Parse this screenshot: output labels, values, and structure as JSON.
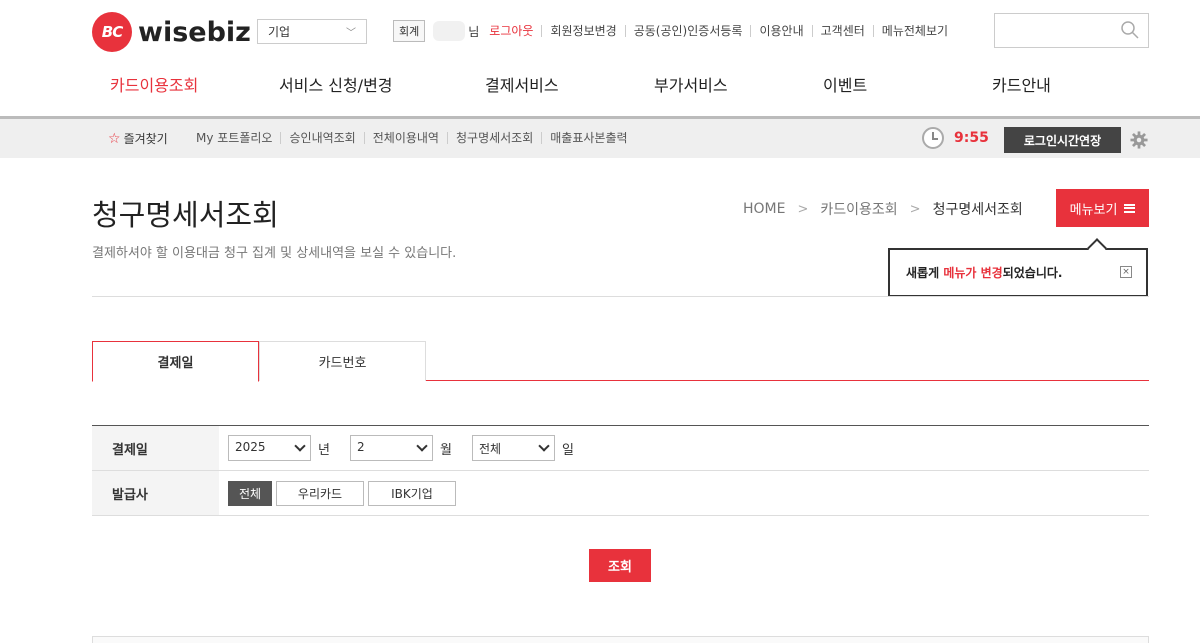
{
  "header": {
    "logo_mark": "BC",
    "logo_text": "wisebiz",
    "company_select": "기업",
    "member_tag": "회계",
    "name_suffix": "님",
    "util_links": [
      "로그아웃",
      "회원정보변경",
      "공동(공인)인증서등록",
      "이용안내",
      "고객센터",
      "메뉴전체보기"
    ],
    "search_placeholder": ""
  },
  "gnb": {
    "items": [
      "카드이용조회",
      "서비스 신청/변경",
      "결제서비스",
      "부가서비스",
      "이벤트",
      "카드안내"
    ]
  },
  "subbar": {
    "favorites": "즐겨찾기",
    "links": [
      "My 포트폴리오",
      "승인내역조회",
      "전체이용내역",
      "청구명세서조회",
      "매출표사본출력"
    ],
    "timer": "9:55",
    "extend_label": "로그인시간연장"
  },
  "page": {
    "title": "청구명세서조회",
    "desc": "결제하셔야 할 이용대금 청구 집계 및 상세내역을 보실 수 있습니다.",
    "breadcrumb": [
      "HOME",
      "카드이용조회",
      "청구명세서조회"
    ],
    "menu_button": "메뉴보기"
  },
  "tooltip": {
    "pre": "새롭게 ",
    "highlight": "메뉴가 변경",
    "post": "되었습니다.",
    "close": "×"
  },
  "tabs": [
    "결제일",
    "카드번호"
  ],
  "form": {
    "row1_label": "결제일",
    "year": "2025",
    "year_unit": "년",
    "month": "2",
    "month_unit": "월",
    "day": "전체",
    "day_unit": "일",
    "row2_label": "발급사",
    "issuers": [
      "전체",
      "우리카드",
      "IBK기업"
    ]
  },
  "search_button": "조회",
  "colors": {
    "accent": "#e8323c",
    "dark": "#444444"
  }
}
